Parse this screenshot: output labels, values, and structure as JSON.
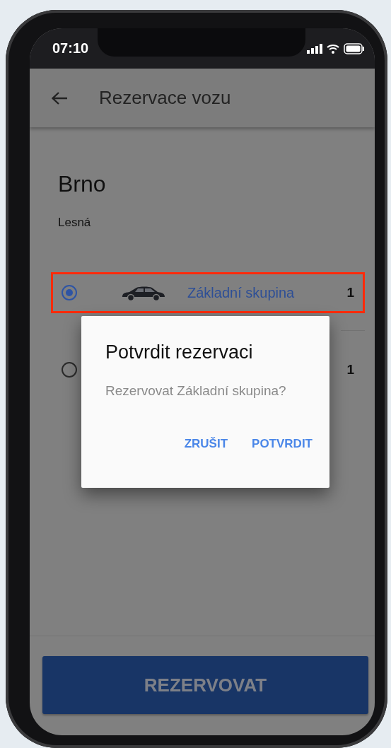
{
  "status_bar": {
    "time": "07:10"
  },
  "app_bar": {
    "title": "Rezervace vozu"
  },
  "location": {
    "city": "Brno",
    "district": "Lesná"
  },
  "groups": [
    {
      "label": "Základní skupina",
      "count": "1",
      "selected": true,
      "highlighted": true
    },
    {
      "count": "1",
      "selected": false,
      "highlighted": false
    }
  ],
  "primary_button": "REZERVOVAT",
  "dialog": {
    "title": "Potvrdit rezervaci",
    "message": "Rezervovat Základní skupina?",
    "buttons": [
      "ZRUŠIT",
      "POTVRDIT"
    ]
  }
}
